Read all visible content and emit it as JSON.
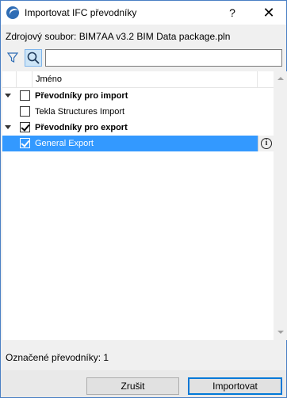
{
  "window": {
    "title": "Importovat IFC převodníky",
    "help_label": "?",
    "close_label": "✕"
  },
  "source": {
    "text": "Zdrojový soubor: BIM7AA v3.2 BIM Data package.pln"
  },
  "search": {
    "value": "",
    "placeholder": ""
  },
  "list": {
    "column_header": "Jméno",
    "rows": [
      {
        "label": "Převodníky pro import",
        "type": "group",
        "expanded": true,
        "checked": false
      },
      {
        "label": "Tekla Structures Import",
        "type": "item",
        "checked": false
      },
      {
        "label": "Převodníky pro export",
        "type": "group",
        "expanded": true,
        "checked": true
      },
      {
        "label": "General Export",
        "type": "item",
        "checked": true,
        "selected": true
      }
    ]
  },
  "status": {
    "selected_count_text": "Označené převodníky: 1"
  },
  "buttons": {
    "cancel_label": "Zrušit",
    "import_label": "Importovat"
  },
  "colors": {
    "selection": "#3399ff",
    "window_border": "#4a7fc4",
    "default_button_border": "#0078d7"
  },
  "icons": {
    "app": "archicad-icon",
    "filter": "filter-icon",
    "search": "search-icon",
    "info": "info-icon"
  }
}
